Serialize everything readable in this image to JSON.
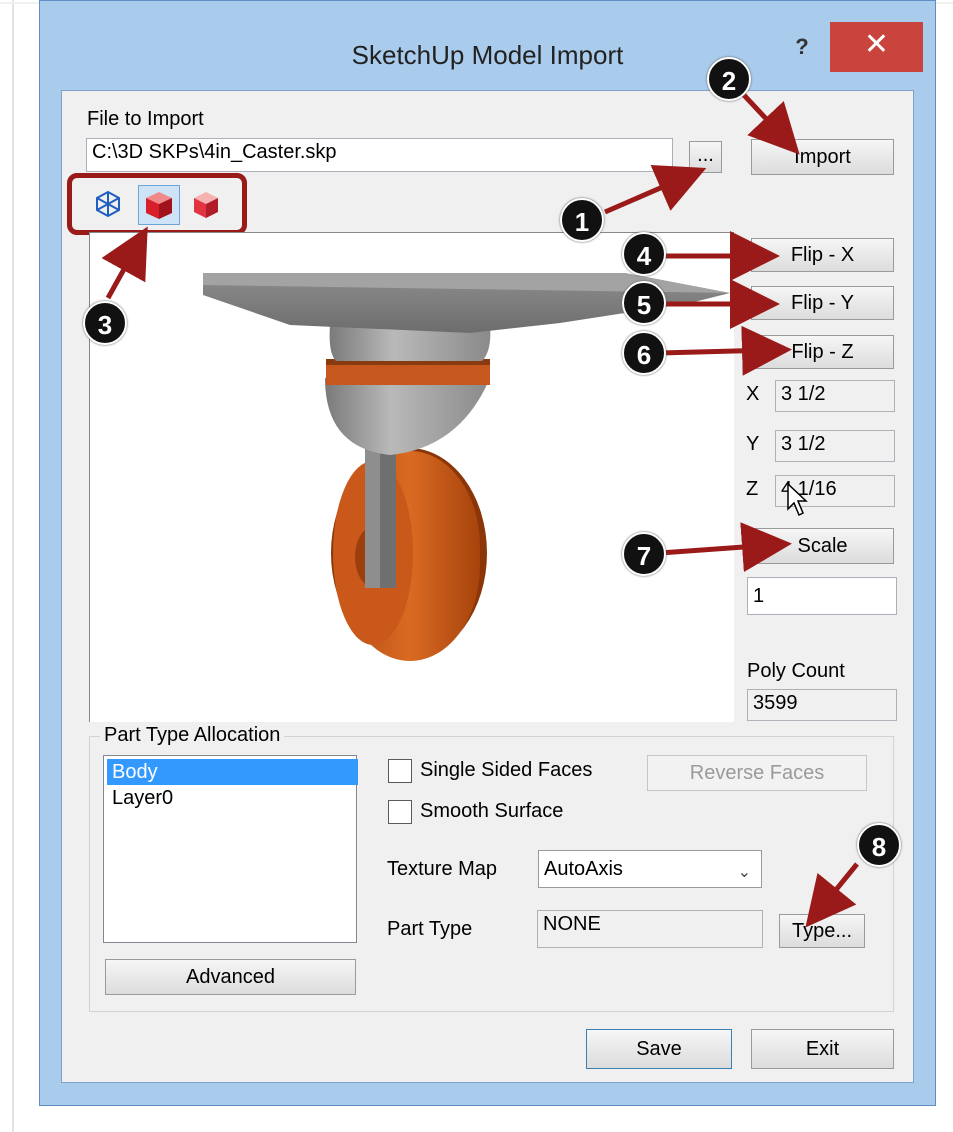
{
  "window": {
    "title": "SketchUp Model Import",
    "help": "?",
    "close": "✕"
  },
  "file": {
    "label": "File to Import",
    "path": "C:\\3D SKPs\\4in_Caster.skp",
    "browse": "..."
  },
  "buttons": {
    "import": "Import",
    "flip_x": "Flip - X",
    "flip_y": "Flip - Y",
    "flip_z": "Flip - Z",
    "scale": "Scale",
    "reverse_faces": "Reverse Faces",
    "type": "Type...",
    "advanced": "Advanced",
    "save": "Save",
    "exit": "Exit"
  },
  "dimensions": {
    "x_label": "X",
    "x_value": "3 1/2",
    "y_label": "Y",
    "y_value": "3 1/2",
    "z_label": "Z",
    "z_value": "4 1/16"
  },
  "scale_value": "1",
  "poly": {
    "label": "Poly Count",
    "value": "3599"
  },
  "part_alloc": {
    "title": "Part Type Allocation",
    "items": [
      "Body",
      "Layer0"
    ],
    "single_sided": "Single Sided Faces",
    "smooth": "Smooth Surface",
    "texture_label": "Texture Map",
    "texture_value": "AutoAxis",
    "part_type_label": "Part Type",
    "part_type_value": "NONE"
  },
  "toolbar_icons": [
    "wireframe-icon",
    "shaded-cube-icon",
    "textured-cube-icon"
  ],
  "callouts": [
    "1",
    "2",
    "3",
    "4",
    "5",
    "6",
    "7",
    "8"
  ],
  "colors": {
    "accent": "#9a1a1a",
    "selection": "#3399ff",
    "close": "#c8443c",
    "frame": "#a9cbec"
  }
}
